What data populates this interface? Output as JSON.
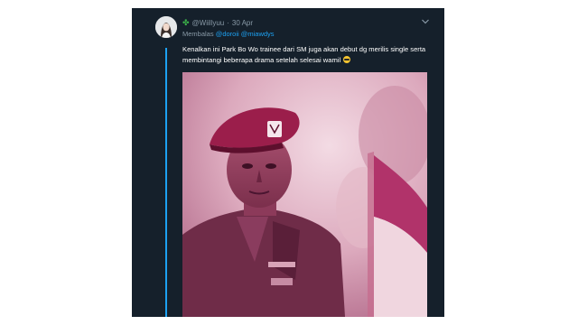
{
  "tweet": {
    "display_name_icon": "four-leaf-clover",
    "handle": "@Wiillyuu",
    "separator": "·",
    "date": "30 Apr",
    "reply_prefix": "Membalas",
    "mentions": [
      "@doroii",
      "@miawdys"
    ],
    "text": "Kenalkan ini Park Bo Wo trainee dari SM juga akan debut dg merilis single serta membintangi beberapa drama setelah selesai wamil",
    "emoji": "smiling-face-with-sunglasses",
    "media_description_icon": "photo"
  },
  "colors": {
    "card_bg": "#15202b",
    "accent": "#1da1f2",
    "muted": "#8899a6",
    "text": "#ffffff",
    "photo_tint": "#c86a8e"
  }
}
